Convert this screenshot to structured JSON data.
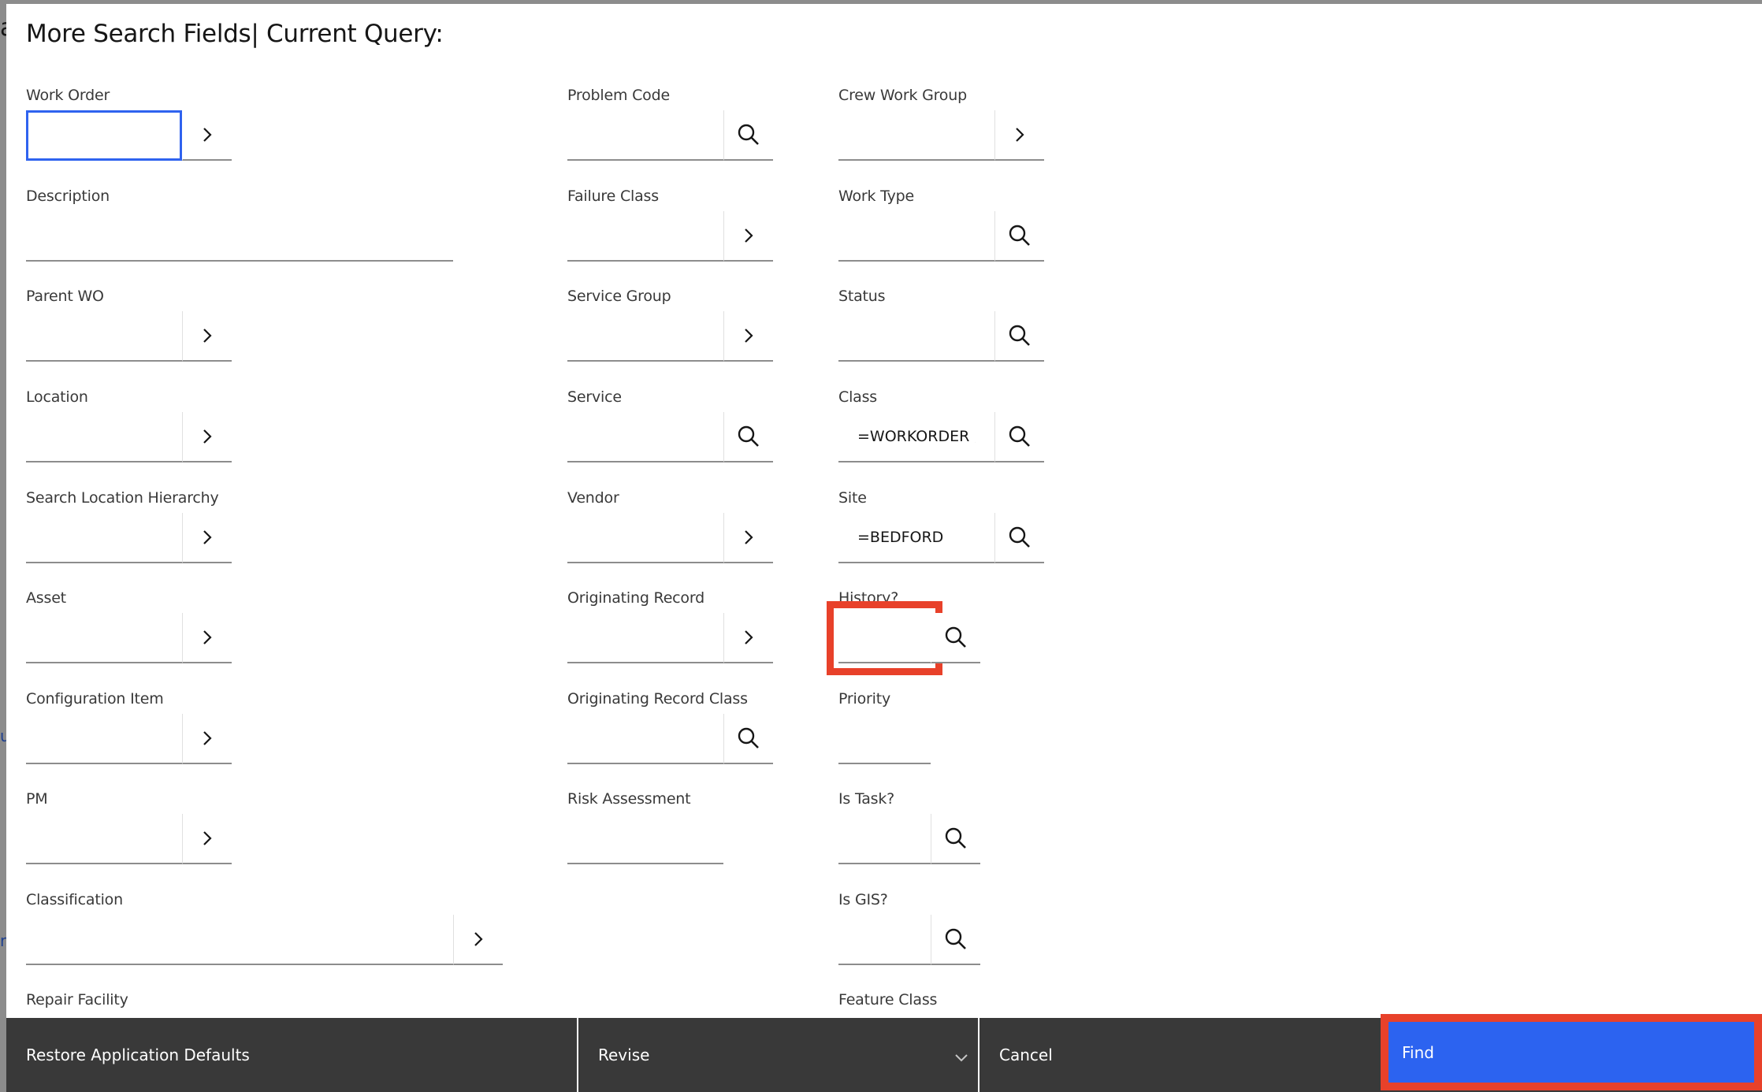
{
  "modal": {
    "title": "More Search Fields| Current Query:"
  },
  "background": {
    "fragments": [
      "a",
      "u",
      "r"
    ]
  },
  "columns": [
    {
      "fields": [
        {
          "label": "Work Order",
          "value": "",
          "button": "chevron-right-icon",
          "focused": true
        },
        {
          "label": "Description",
          "value": "",
          "button": null
        },
        {
          "label": "Parent WO",
          "value": "",
          "button": "chevron-right-icon"
        },
        {
          "label": "Location",
          "value": "",
          "button": "chevron-right-icon"
        },
        {
          "label": "Search Location Hierarchy",
          "value": "",
          "button": "chevron-right-icon"
        },
        {
          "label": "Asset",
          "value": "",
          "button": "chevron-right-icon"
        },
        {
          "label": "Configuration Item",
          "value": "",
          "button": "chevron-right-icon"
        },
        {
          "label": "PM",
          "value": "",
          "button": "chevron-right-icon"
        },
        {
          "label": "Classification",
          "value": "",
          "button": "chevron-right-icon"
        },
        {
          "label": "Repair Facility",
          "value": "",
          "button": null
        }
      ]
    },
    {
      "fields": [
        {
          "label": "Problem Code",
          "value": "",
          "button": "search-icon"
        },
        {
          "label": "Failure Class",
          "value": "",
          "button": "chevron-right-icon"
        },
        {
          "label": "Service Group",
          "value": "",
          "button": "chevron-right-icon"
        },
        {
          "label": "Service",
          "value": "",
          "button": "search-icon"
        },
        {
          "label": "Vendor",
          "value": "",
          "button": "chevron-right-icon"
        },
        {
          "label": "Originating Record",
          "value": "",
          "button": "chevron-right-icon"
        },
        {
          "label": "Originating Record Class",
          "value": "",
          "button": "search-icon"
        },
        {
          "label": "Risk Assessment",
          "value": "",
          "button": null
        }
      ]
    },
    {
      "fields": [
        {
          "label": "Crew Work Group",
          "value": "",
          "button": "chevron-right-icon"
        },
        {
          "label": "Work Type",
          "value": "",
          "button": "search-icon"
        },
        {
          "label": "Status",
          "value": "",
          "button": "search-icon"
        },
        {
          "label": "Class",
          "value": "=WORKORDER ,",
          "button": "search-icon"
        },
        {
          "label": "Site",
          "value": "=BEDFORD",
          "button": "search-icon"
        },
        {
          "label": "History?",
          "value": "",
          "button": "search-icon",
          "highlighted": true
        },
        {
          "label": "Priority",
          "value": "",
          "button": null
        },
        {
          "label": "Is Task?",
          "value": "",
          "button": "search-icon"
        },
        {
          "label": "Is GIS?",
          "value": "",
          "button": "search-icon"
        },
        {
          "label": "Feature Class",
          "value": "",
          "button": null
        }
      ]
    }
  ],
  "footer": {
    "restore_label": "Restore Application Defaults",
    "revise_label": "Revise",
    "cancel_label": "Cancel",
    "find_label": "Find"
  },
  "colors": {
    "primary_button": "#2c63f0",
    "footer_bg": "#393939",
    "focus_border": "#2f63ef",
    "annotation_red": "#e8412a"
  }
}
